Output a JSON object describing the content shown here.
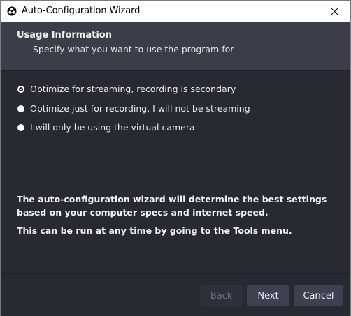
{
  "window": {
    "title": "Auto-Configuration Wizard"
  },
  "header": {
    "title": "Usage Information",
    "subtitle": "Specify what you want to use the program for"
  },
  "options": [
    {
      "label": "Optimize for streaming, recording is secondary",
      "checked": true
    },
    {
      "label": "Optimize just for recording, I will not be streaming",
      "checked": false
    },
    {
      "label": "I will only be using the virtual camera",
      "checked": false
    }
  ],
  "info": {
    "line1": "The auto-configuration wizard will determine the best settings based on your computer specs and internet speed.",
    "line2": "This can be run at any time by going to the Tools menu."
  },
  "buttons": {
    "back": "Back",
    "next": "Next",
    "cancel": "Cancel"
  },
  "colors": {
    "background": "#272a33",
    "header_background": "#3b3e48",
    "button_background": "#3e4250",
    "disabled_text": "#6c6f78"
  },
  "icons": {
    "app": "obs-logo-icon",
    "close": "close-icon"
  }
}
